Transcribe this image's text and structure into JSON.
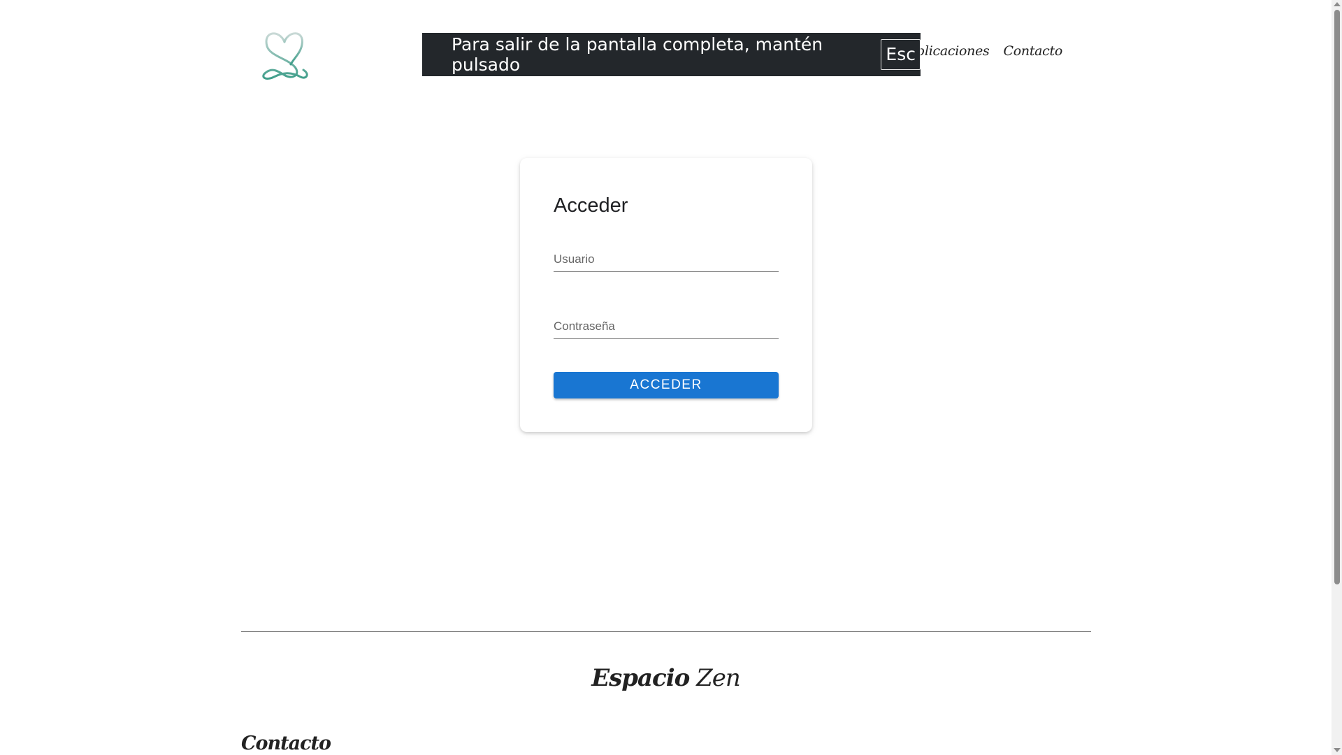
{
  "header": {
    "logo_icon": "infinity-heart-logo",
    "nav": [
      {
        "label": "Publicaciones"
      },
      {
        "label": "Contacto"
      }
    ]
  },
  "fullscreen_notice": {
    "text": "Para salir de la pantalla completa, mantén pulsado",
    "key": "Esc"
  },
  "login": {
    "title": "Acceder",
    "username_placeholder": "Usuario",
    "password_placeholder": "Contraseña",
    "submit_label": "ACCEDER",
    "accent_color": "#1976d2"
  },
  "footer": {
    "brand_bold": "Espacio",
    "brand_light": "Zen",
    "contact_heading": "Contacto"
  }
}
